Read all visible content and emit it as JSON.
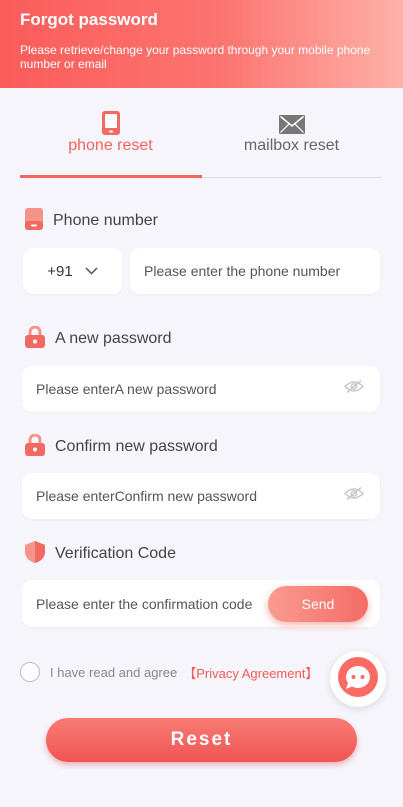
{
  "header": {
    "title": "Forgot password",
    "subtitle": "Please retrieve/change your password through your mobile phone number or email"
  },
  "tabs": [
    {
      "label": "phone reset",
      "icon": "phone-icon",
      "active": true
    },
    {
      "label": "mailbox reset",
      "icon": "envelope-icon",
      "active": false
    }
  ],
  "form": {
    "phone_label": "Phone number",
    "country_code": "+91",
    "phone_placeholder": "Please enter the phone number",
    "new_password_label": "A new password",
    "new_password_placeholder": "Please enterA new password",
    "confirm_password_label": "Confirm new password",
    "confirm_password_placeholder": "Please enterConfirm new password",
    "verification_label": "Verification Code",
    "verification_placeholder": "Please enter the confirmation code",
    "send_label": "Send"
  },
  "agreement": {
    "text": "I have read and agree",
    "link": "【Privacy Agreement】",
    "checked": false
  },
  "reset_label": "Reset",
  "colors": {
    "accent": "#f3635e",
    "header_start": "#fb5c5a",
    "header_end": "#fdb2a9",
    "background": "#f6f5fc"
  }
}
